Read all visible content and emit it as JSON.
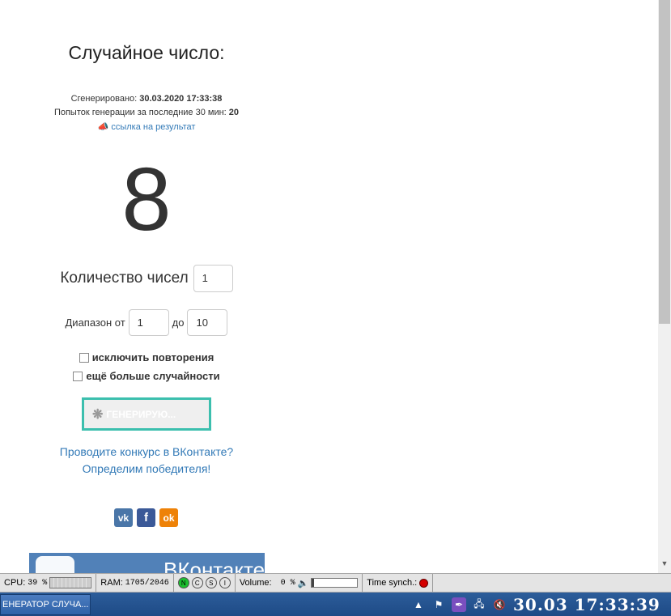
{
  "main": {
    "title": "Случайное число:",
    "generated_label": "Сгенерировано:",
    "generated_value": "30.03.2020 17:33:38",
    "attempts_label": "Попыток генерации за последние 30 мин:",
    "attempts_value": "20",
    "result_link": "ссылка на результат",
    "number": "8",
    "count_label": "Количество чисел",
    "count_value": "1",
    "range_from_label": "Диапазон от",
    "range_from_value": "1",
    "range_to_label": "до",
    "range_to_value": "10",
    "exclude_repeats_label": "исключить повторения",
    "more_random_label": "ещё больше случайности",
    "generate_button": "ГЕНЕРИРУЮ...",
    "vk_contest_line1": "Проводите конкурс в ВКонтакте?",
    "vk_contest_line2": "Определим победителя!",
    "social": [
      "vk",
      "f",
      "ok"
    ],
    "vk_banner_text": "ВКонтакте"
  },
  "statusbar": {
    "cpu_label": "CPU:",
    "cpu_value": "39 %",
    "ram_label": "RAM:",
    "ram_value": "1705/2046",
    "circles": [
      "N",
      "C",
      "S",
      "I"
    ],
    "volume_label": "Volume:",
    "volume_value": "0 %",
    "time_synch_label": "Time synch.:",
    "time_synch_color": "#d40000"
  },
  "taskbar": {
    "task_item": "ЕНЕРАТОР СЛУЧА...",
    "clock": "30.03  17:33:39"
  }
}
